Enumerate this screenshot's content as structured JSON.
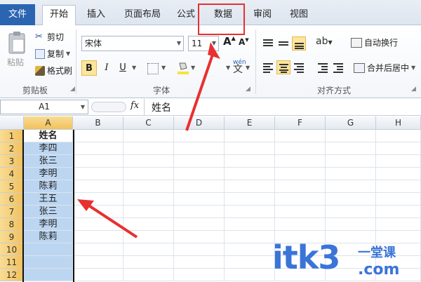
{
  "tabs": [
    "文件",
    "开始",
    "插入",
    "页面布局",
    "公式",
    "数据",
    "审阅",
    "视图"
  ],
  "clipboard": {
    "paste": "粘贴",
    "cut": "剪切",
    "copy": "复制",
    "format_painter": "格式刷",
    "group": "剪贴板"
  },
  "font": {
    "name": "宋体",
    "size": "11",
    "bold": "B",
    "italic": "I",
    "underline": "U",
    "wen": "wén",
    "group": "字体"
  },
  "alignment": {
    "wrap": "自动换行",
    "merge": "合并后居中",
    "group": "对齐方式"
  },
  "formula_bar": {
    "cell_ref": "A1",
    "fx": "fx",
    "value": "姓名"
  },
  "columns": [
    "A",
    "B",
    "C",
    "D",
    "E",
    "F",
    "G",
    "H"
  ],
  "rows": [
    "1",
    "2",
    "3",
    "4",
    "5",
    "6",
    "7",
    "8",
    "9",
    "10",
    "11",
    "12"
  ],
  "column_a": [
    "姓名",
    "李四",
    "张三",
    "李明",
    "陈莉",
    "王五",
    "张三",
    "李明",
    "陈莉",
    "",
    "",
    ""
  ],
  "watermark": {
    "text": "itk3",
    "sub1": "一堂课",
    "sub2": ".com"
  },
  "colors": {
    "accent": "#2b64b1",
    "highlight": "#fde69a",
    "selection": "#bcd6f2",
    "annotation": "#e83030"
  }
}
